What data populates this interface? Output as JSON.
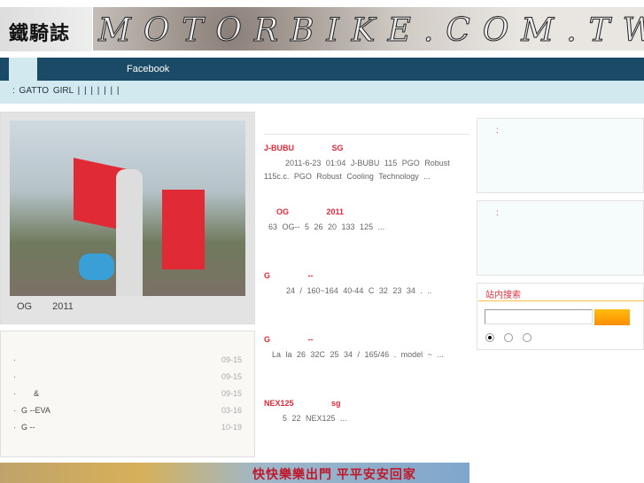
{
  "header": {
    "logo_text": "鐵騎誌",
    "banner_text": "MOTORBIKE.COM.TW"
  },
  "nav": {
    "items": [
      "Facebook"
    ]
  },
  "subnav": {
    "text": ":  GATTO GIRL |    |    |    |    |    |    |"
  },
  "feature": {
    "caption": "OG 2011"
  },
  "list": [
    {
      "title": "",
      "date": "09-15"
    },
    {
      "title": "",
      "date": "09-15"
    },
    {
      "title": "&",
      "date": "09-15"
    },
    {
      "title": "G --EVA",
      "date": "03-16"
    },
    {
      "title": "G --",
      "date": "10-19"
    }
  ],
  "articles": [
    {
      "title": "J-BUBU SG",
      "body": "2011-6-23 01:04 J-BUBU 115 PGO Robust 115c.c. PGO Robust Cooling Technology ..."
    },
    {
      "title": "OG 2011",
      "body": "63 OG-- 5 26 20 133 125 ..."
    },
    {
      "title": "G --",
      "body": "24 / 160~164 40-44 C 32 23 34 . .."
    },
    {
      "title": "G --",
      "body": "La la 26 32C 25 34 / 165/46 . model ~ ..."
    },
    {
      "title": "NEX125 sg",
      "body": "5 22 NEX125 ..."
    }
  ],
  "sidebar": {
    "box1_label": ":",
    "box2_label": ":",
    "search_title": "站内搜索",
    "search_value": ""
  },
  "bottom_banner": {
    "text": "快快樂樂出門 平平安安回家"
  }
}
